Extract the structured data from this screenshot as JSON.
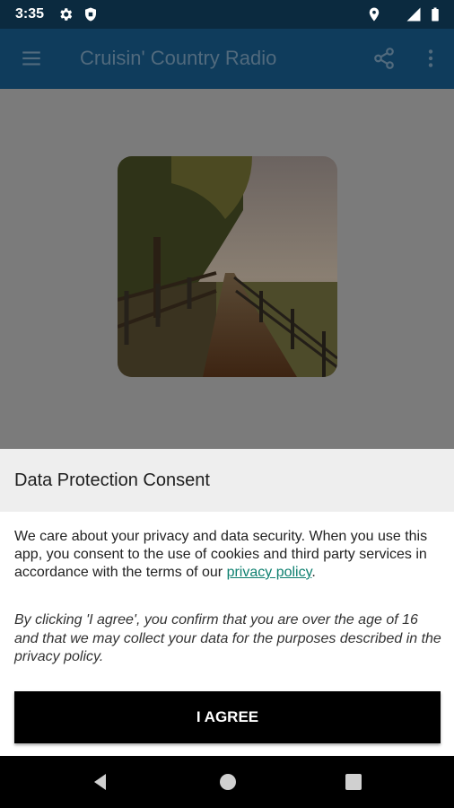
{
  "status_bar": {
    "time": "3:35",
    "icons": [
      "gear-icon",
      "shield-icon",
      "location-icon",
      "signal-icon",
      "battery-icon"
    ]
  },
  "toolbar": {
    "title": "Cruisin' Country Radio",
    "icons": [
      "menu-icon",
      "share-icon",
      "more-vert-icon"
    ]
  },
  "artwork": {
    "description_icon": "station-artwork"
  },
  "consent": {
    "title": "Data Protection Consent",
    "body_text": "We care about your privacy and data security. When you use this app, you consent to the use of cookies and third party services in accordance with the terms of our",
    "link_text": "privacy policy",
    "body_end": ".",
    "note": "By clicking 'I agree', you confirm that you are over the age of 16 and that we may collect your data for the purposes described in the privacy policy.",
    "agree_label": "I AGREE"
  },
  "nav_bar": {
    "icons": [
      "back-icon",
      "home-icon",
      "recents-icon"
    ]
  },
  "colors": {
    "status_bar": "#0b2a3f",
    "toolbar": "#0f3c5c",
    "toolbar_title": "#516a7d",
    "scrim": "#7b7b7b",
    "link": "#0f8070",
    "button": "#000000"
  }
}
